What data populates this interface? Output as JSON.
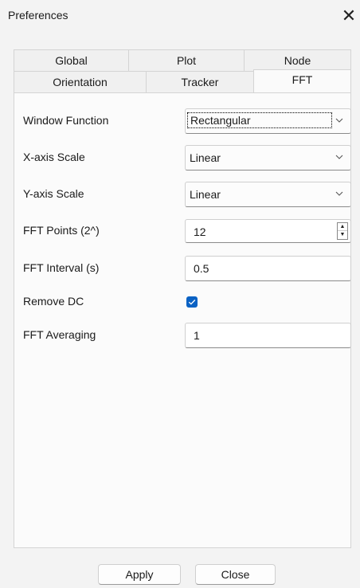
{
  "window": {
    "title": "Preferences",
    "close_glyph": "✕"
  },
  "tabs": {
    "row1": [
      {
        "label": "Global"
      },
      {
        "label": "Plot"
      },
      {
        "label": "Node"
      }
    ],
    "row2": [
      {
        "label": "Orientation"
      },
      {
        "label": "Tracker"
      },
      {
        "label": "FFT",
        "active": true
      }
    ]
  },
  "fft": {
    "window_function": {
      "label": "Window Function",
      "value": "Rectangular"
    },
    "x_axis_scale": {
      "label": "X-axis Scale",
      "value": "Linear"
    },
    "y_axis_scale": {
      "label": "Y-axis Scale",
      "value": "Linear"
    },
    "fft_points": {
      "label": "FFT Points (2^)",
      "value": "12"
    },
    "fft_interval": {
      "label": "FFT Interval (s)",
      "value": "0.5"
    },
    "remove_dc": {
      "label": "Remove DC",
      "checked": true
    },
    "fft_averaging": {
      "label": "FFT Averaging",
      "value": "1"
    }
  },
  "footer": {
    "apply_label": "Apply",
    "close_label": "Close"
  },
  "colors": {
    "accent": "#0a62c4"
  },
  "icons": {
    "close": "close-icon",
    "chevron": "chevron-down-icon",
    "check": "checkmark-icon",
    "spin_up": "spin-up-icon",
    "spin_down": "spin-down-icon"
  }
}
